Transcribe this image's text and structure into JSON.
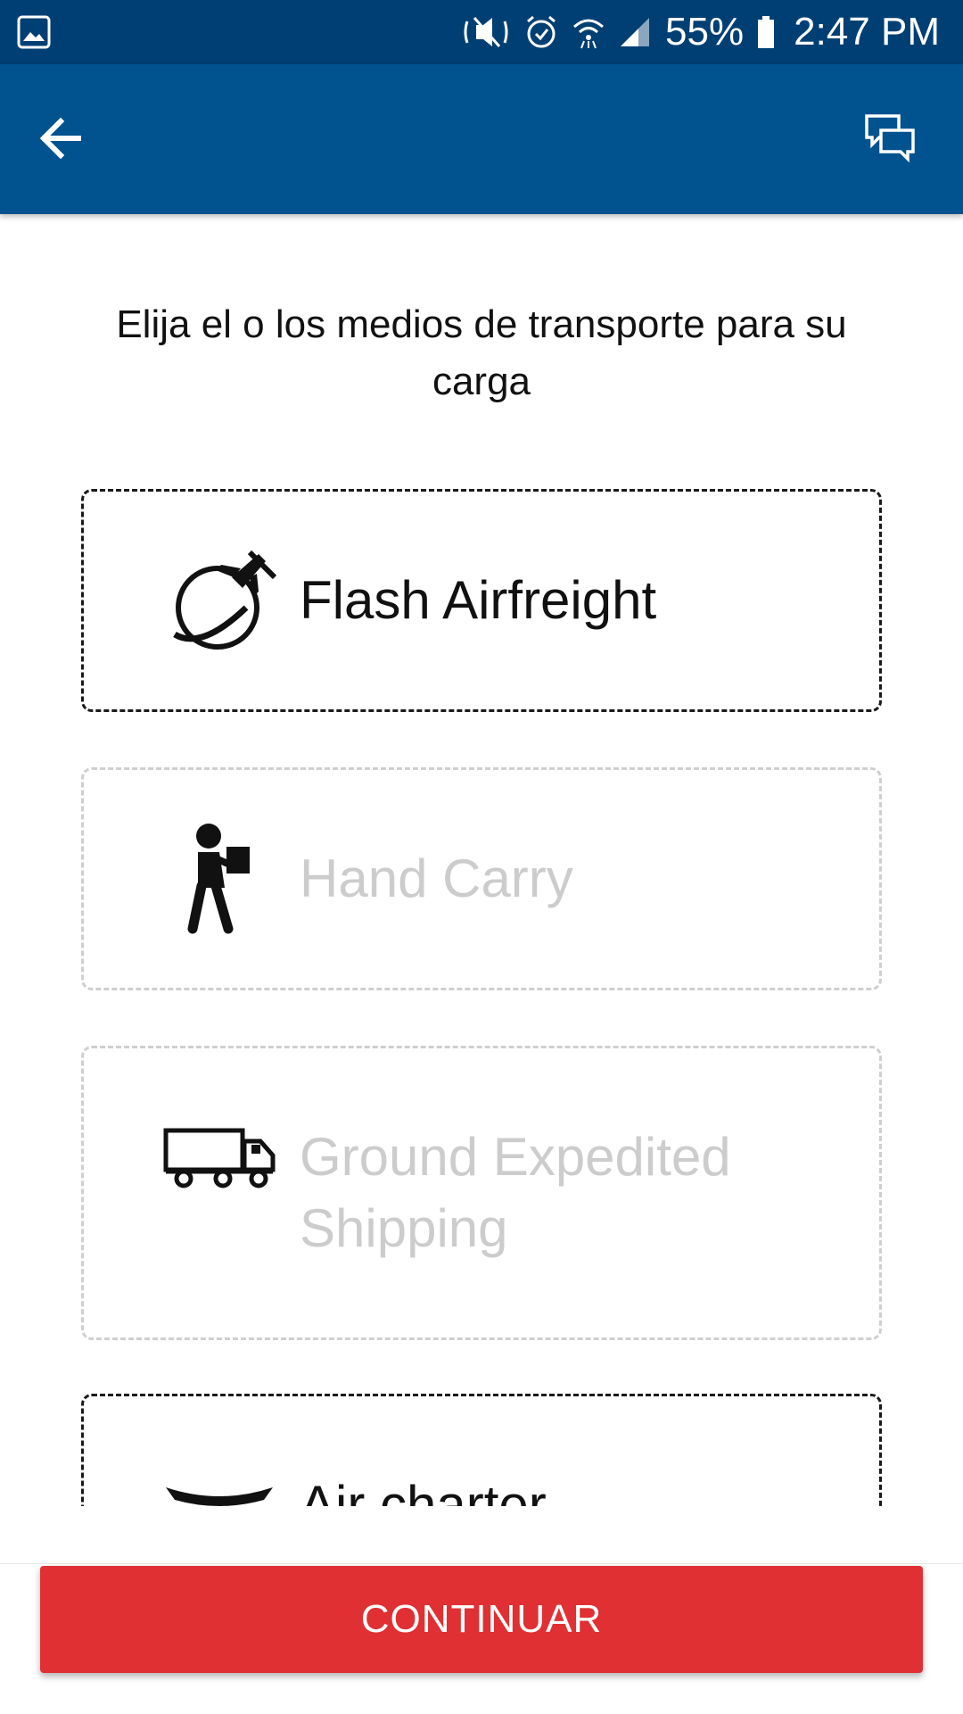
{
  "status_bar": {
    "battery_percent": "55%",
    "time": "2:47 PM",
    "icons": [
      "gallery-icon",
      "mute-icon",
      "alarm-icon",
      "wifi-icon",
      "signal-icon",
      "battery-icon"
    ]
  },
  "app_bar": {
    "icons": [
      "back-arrow-icon",
      "chat-icon"
    ]
  },
  "instruction": "Elija el o los medios de transporte para su carga",
  "options": [
    {
      "label": "Flash Airfreight",
      "icon": "plane-globe-icon",
      "state": "enabled"
    },
    {
      "label": "Hand Carry",
      "icon": "person-carrying-box-icon",
      "state": "disabled"
    },
    {
      "label": "Ground Expedited Shipping",
      "icon": "truck-icon",
      "state": "disabled"
    },
    {
      "label": "Air charter",
      "icon": "airplane-icon",
      "state": "enabled"
    }
  ],
  "continue_label": "CONTINUAR",
  "colors": {
    "status_bar": "#003f73",
    "app_bar": "#00538f",
    "continue_button": "#e03033",
    "disabled_text": "#cccccc"
  }
}
